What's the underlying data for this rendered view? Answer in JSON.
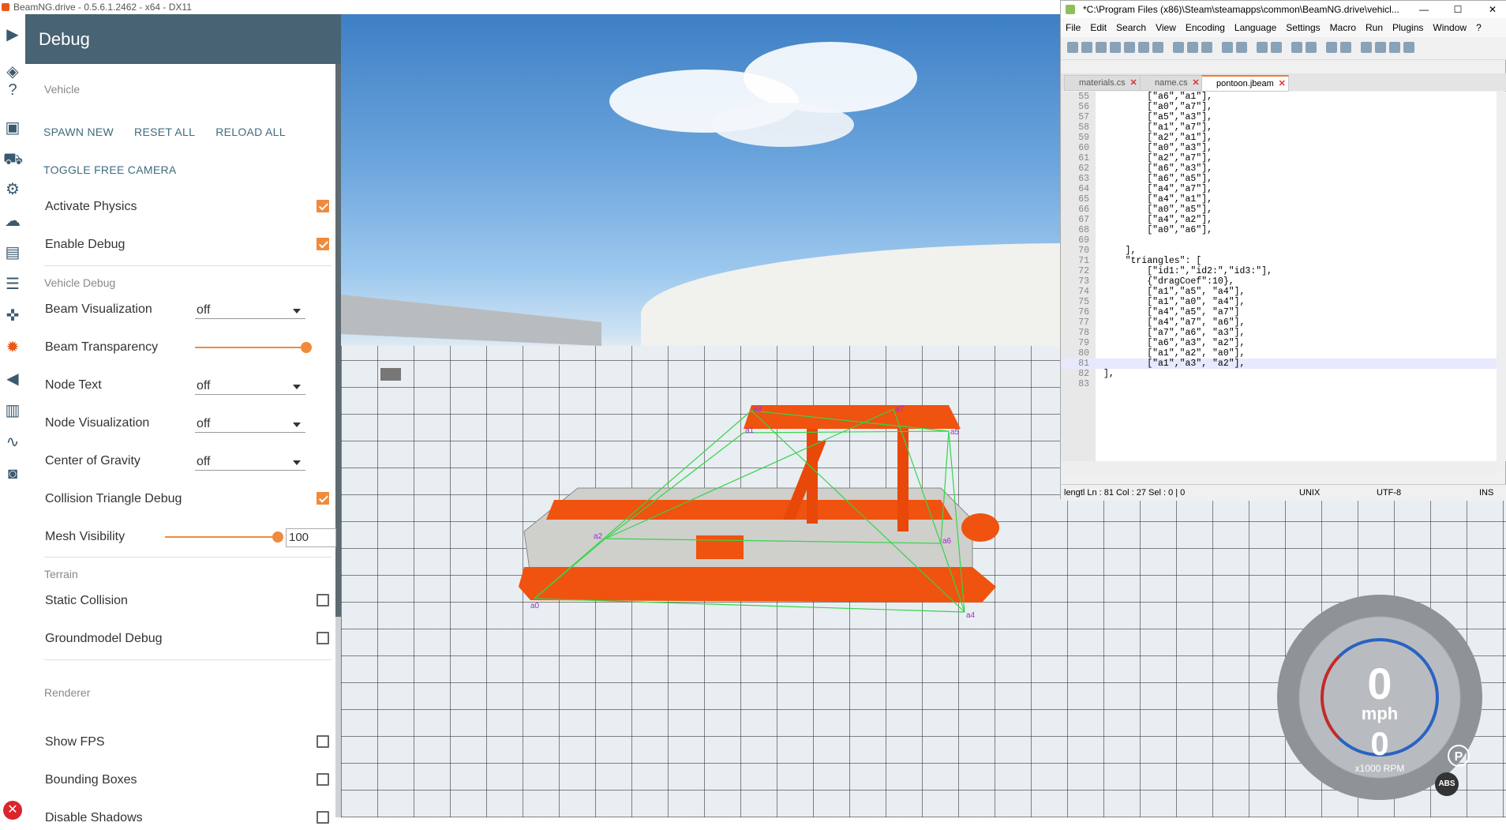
{
  "window_title": "BeamNG.drive - 0.5.6.1.2462 - x64 - DX11",
  "panel": {
    "title": "Debug",
    "sections": {
      "vehicle": "Vehicle",
      "vehicle_debug": "Vehicle Debug",
      "terrain": "Terrain",
      "renderer": "Renderer"
    },
    "actions": {
      "spawn_new": "SPAWN NEW",
      "reset_all": "RESET ALL",
      "reload_all": "RELOAD ALL",
      "toggle_free_camera": "TOGGLE FREE CAMERA"
    },
    "activate_physics": {
      "label": "Activate Physics",
      "checked": true
    },
    "enable_debug": {
      "label": "Enable Debug",
      "checked": true
    },
    "beam_visualization": {
      "label": "Beam Visualization",
      "value": "off"
    },
    "beam_transparency": {
      "label": "Beam Transparency",
      "level": 1.0
    },
    "node_text": {
      "label": "Node Text",
      "value": "off"
    },
    "node_visualization": {
      "label": "Node Visualization",
      "value": "off"
    },
    "center_of_gravity": {
      "label": "Center of Gravity",
      "value": "off"
    },
    "collision_triangle_debug": {
      "label": "Collision Triangle Debug",
      "checked": true
    },
    "mesh_visibility": {
      "label": "Mesh Visibility",
      "value": "100"
    },
    "static_collision": {
      "label": "Static Collision",
      "checked": false
    },
    "groundmodel_debug": {
      "label": "Groundmodel Debug",
      "checked": false
    },
    "show_fps": {
      "label": "Show FPS",
      "checked": false
    },
    "bounding_boxes": {
      "label": "Bounding Boxes",
      "checked": false
    },
    "disable_shadows": {
      "label": "Disable Shadows",
      "checked": false
    }
  },
  "node_labels": [
    "a3",
    "a7",
    "a1",
    "a5",
    "a2",
    "a6",
    "a0",
    "a4"
  ],
  "hud": {
    "speed": "0",
    "speed_unit": "mph",
    "rpm": "0",
    "rpm_unit": "x1000 RPM",
    "gear": "P",
    "abs": "ABS"
  },
  "notepad": {
    "title": "*C:\\Program Files (x86)\\Steam\\steamapps\\common\\BeamNG.drive\\vehicl...",
    "menu": [
      "File",
      "Edit",
      "Search",
      "View",
      "Encoding",
      "Language",
      "Settings",
      "Macro",
      "Run",
      "Plugins",
      "Window",
      "?"
    ],
    "tabs": [
      "materials.cs",
      "name.cs",
      "pontoon.jbeam"
    ],
    "lines": [
      {
        "n": "55",
        "text": "        [\"a6\",\"a1\"],"
      },
      {
        "n": "56",
        "text": "        [\"a0\",\"a7\"],"
      },
      {
        "n": "57",
        "text": "        [\"a5\",\"a3\"],"
      },
      {
        "n": "58",
        "text": "        [\"a1\",\"a7\"],"
      },
      {
        "n": "59",
        "text": "        [\"a2\",\"a1\"],"
      },
      {
        "n": "60",
        "text": "        [\"a0\",\"a3\"],"
      },
      {
        "n": "61",
        "text": "        [\"a2\",\"a7\"],"
      },
      {
        "n": "62",
        "text": "        [\"a6\",\"a3\"],"
      },
      {
        "n": "63",
        "text": "        [\"a6\",\"a5\"],"
      },
      {
        "n": "64",
        "text": "        [\"a4\",\"a7\"],"
      },
      {
        "n": "65",
        "text": "        [\"a4\",\"a1\"],"
      },
      {
        "n": "66",
        "text": "        [\"a0\",\"a5\"],"
      },
      {
        "n": "67",
        "text": "        [\"a4\",\"a2\"],"
      },
      {
        "n": "68",
        "text": "        [\"a0\",\"a6\"],"
      },
      {
        "n": "69",
        "text": ""
      },
      {
        "n": "70",
        "text": "    ],"
      },
      {
        "n": "71",
        "text": "    \"triangles\": ["
      },
      {
        "n": "72",
        "text": "        [\"id1:\",\"id2:\",\"id3:\"],"
      },
      {
        "n": "73",
        "text": "        {\"dragCoef\":10},"
      },
      {
        "n": "74",
        "text": "        [\"a1\",\"a5\", \"a4\"],"
      },
      {
        "n": "75",
        "text": "        [\"a1\",\"a0\", \"a4\"],"
      },
      {
        "n": "76",
        "text": "        [\"a4\",\"a5\", \"a7\"]"
      },
      {
        "n": "77",
        "text": "        [\"a4\",\"a7\", \"a6\"],"
      },
      {
        "n": "78",
        "text": "        [\"a7\",\"a6\", \"a3\"],"
      },
      {
        "n": "79",
        "text": "        [\"a6\",\"a3\", \"a2\"],"
      },
      {
        "n": "80",
        "text": "        [\"a1\",\"a2\", \"a0\"],"
      },
      {
        "n": "81",
        "text": "        [\"a1\",\"a3\", \"a2\"],"
      },
      {
        "n": "82",
        "text": "],"
      },
      {
        "n": "83",
        "text": ""
      }
    ],
    "status": {
      "left": "lengtl Ln : 81    Col : 27    Sel : 0 | 0",
      "eol": "UNIX",
      "encoding": "UTF-8",
      "mode": "INS"
    }
  },
  "colors": {
    "accent": "#f08a3c",
    "header": "#486373",
    "boat": "#f0520f",
    "wire": "#36d44a",
    "node": "#9b30d0"
  }
}
